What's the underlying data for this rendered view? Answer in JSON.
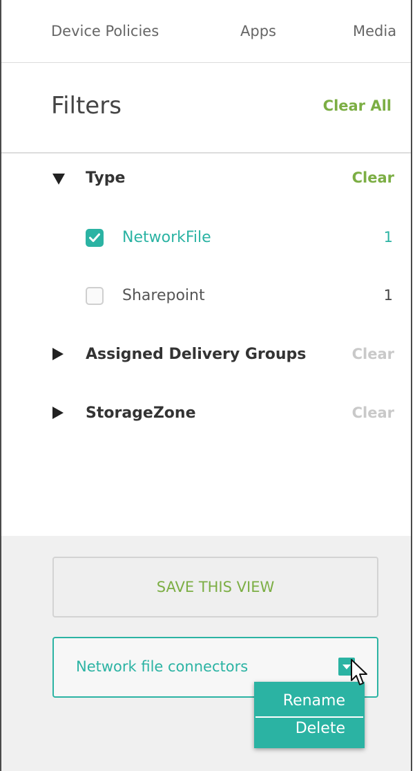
{
  "tabs": [
    {
      "label": "Device Policies"
    },
    {
      "label": "Apps"
    },
    {
      "label": "Media"
    }
  ],
  "filters": {
    "title": "Filters",
    "clear_all_label": "Clear All"
  },
  "sections": [
    {
      "label": "Type",
      "expanded": true,
      "clear_label": "Clear",
      "clear_enabled": true,
      "options": [
        {
          "label": "NetworkFile",
          "count": "1",
          "checked": true
        },
        {
          "label": "Sharepoint",
          "count": "1",
          "checked": false
        }
      ]
    },
    {
      "label": "Assigned Delivery Groups",
      "expanded": false,
      "clear_label": "Clear",
      "clear_enabled": false
    },
    {
      "label": "StorageZone",
      "expanded": false,
      "clear_label": "Clear",
      "clear_enabled": false
    }
  ],
  "save_view": {
    "label": "SAVE THIS VIEW"
  },
  "saved_view": {
    "selected": "Network file connectors",
    "menu": [
      {
        "label": "Rename"
      },
      {
        "label": "Delete"
      }
    ]
  },
  "colors": {
    "accent_teal": "#2bb3a3",
    "accent_green": "#7cae44",
    "disabled": "#c9c9c9"
  },
  "icons": {
    "expanded": "triangle-down-icon",
    "collapsed": "triangle-right-icon",
    "checked": "checkmark-icon",
    "dropdown": "chevron-down-icon",
    "cursor": "mouse-pointer-icon"
  }
}
